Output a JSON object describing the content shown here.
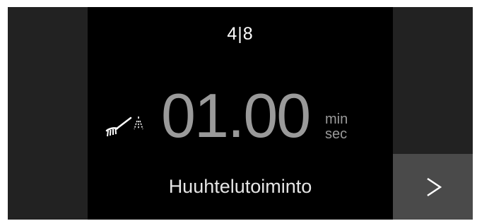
{
  "display": {
    "step_counter": "4|8",
    "time_value": "01.00",
    "unit_top": "min",
    "unit_bottom": "sec",
    "program_name": "Huuhtelutoiminto",
    "icon": "rinse-spray-icon"
  },
  "navigation": {
    "next_icon": "play-arrow-icon"
  },
  "colors": {
    "screen_bg": "#000000",
    "side_panel_bg": "#222222",
    "button_bg": "#4a4a4a",
    "time_text": "#9a9a9a",
    "label_text": "#ffffff"
  }
}
